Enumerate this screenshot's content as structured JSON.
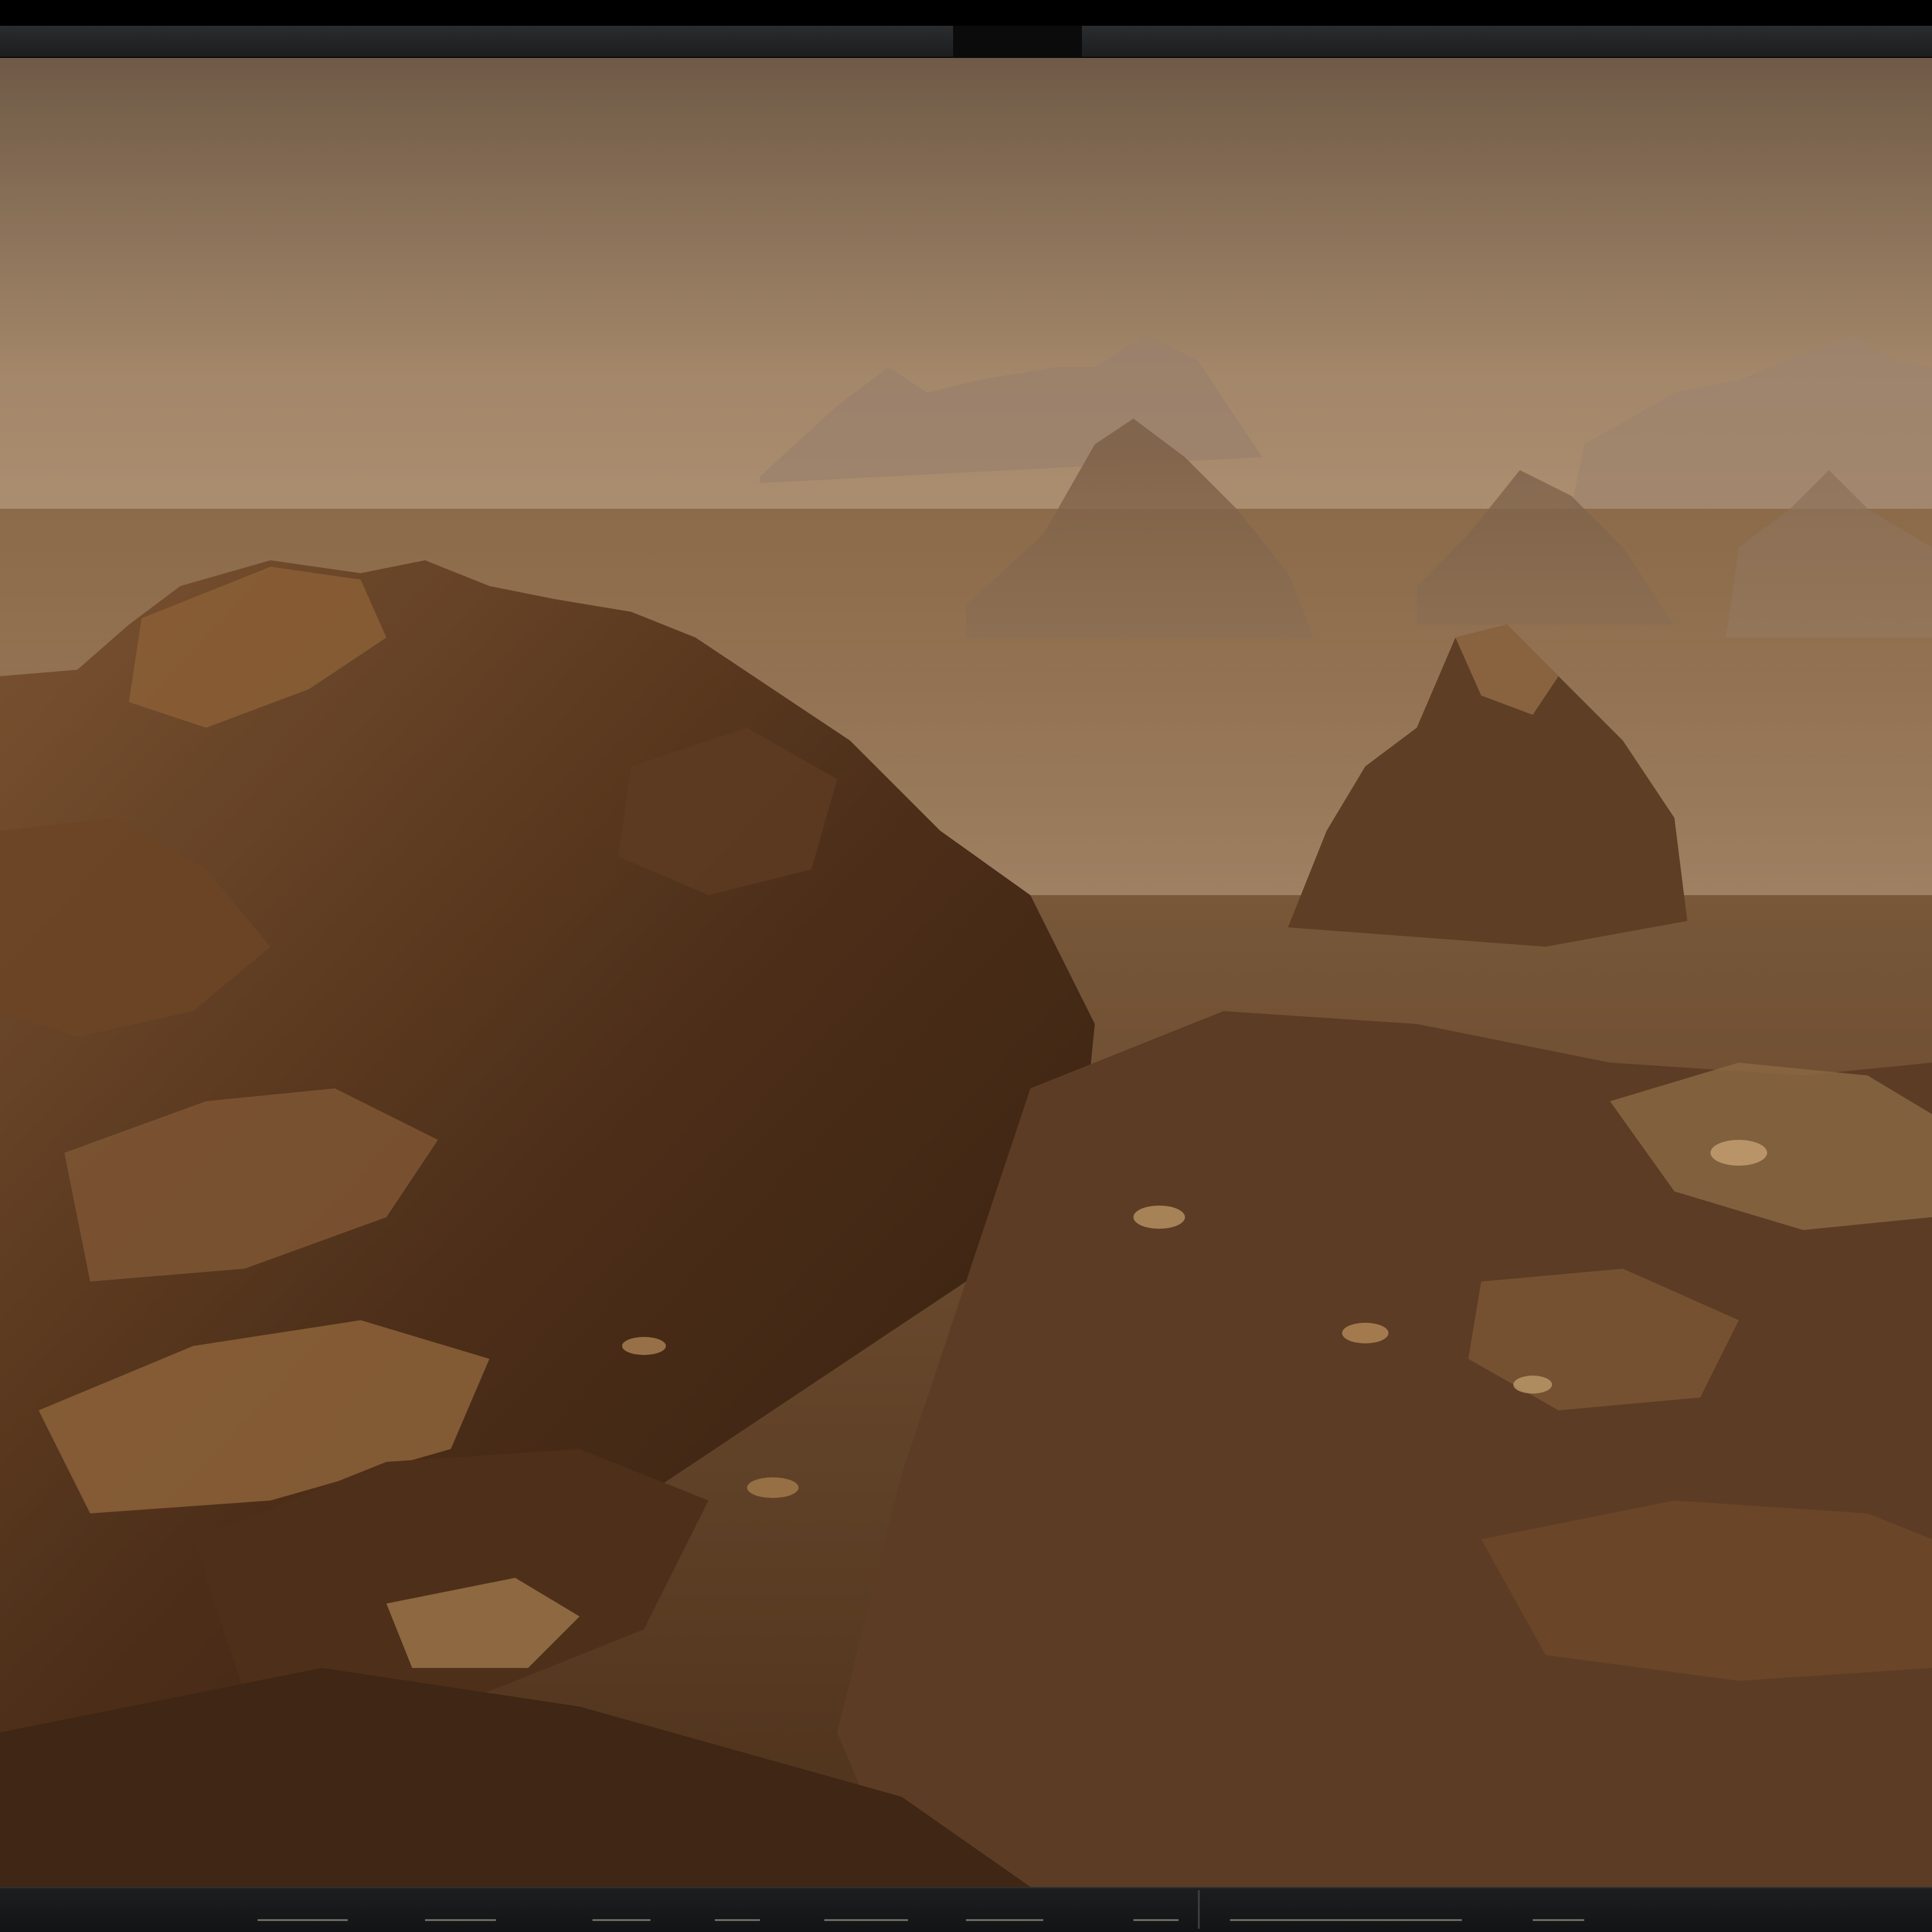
{
  "window": {
    "title": "",
    "toolbar_items": 10
  },
  "scene": {
    "subject": "",
    "colors": {
      "sky_top": "#7a6650",
      "sky_haze": "#b89c7e",
      "rock_dark": "#3a2414",
      "rock_mid": "#6b4424",
      "rock_light": "#b88a52",
      "dust": "#8a6a4a"
    }
  }
}
